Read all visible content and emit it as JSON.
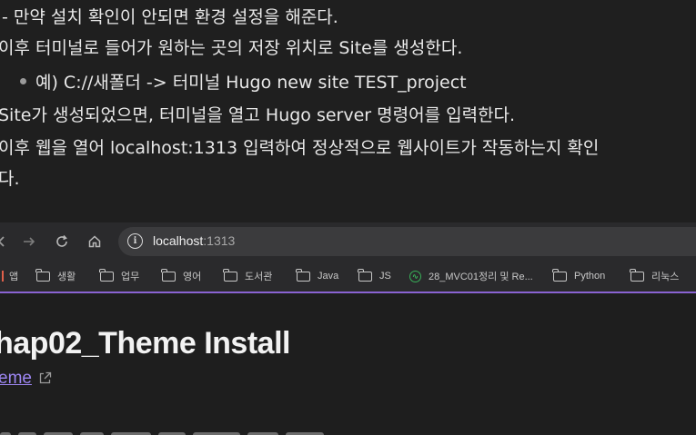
{
  "doc": {
    "lines": [
      "- 만약 설치 확인이 안되면 환경 설정을 해준다.",
      "이후 터미널로 들어가 원하는 곳의 저장 위치로 Site를 생성한다.",
      "예) C://새폴더 -> 터미널 Hugo new site TEST_project",
      "Site가 생성되었으면, 터미널을 열고 Hugo server 명령어를 입력한다.",
      "이후 웹을 열어 localhost:1313 입력하여 정상적으로 웹사이트가 작동하는지 확인",
      "다."
    ]
  },
  "browser": {
    "address": {
      "host": "localhost",
      "port": ":1313"
    },
    "bookmarks": [
      "앱",
      "생활",
      "업무",
      "영어",
      "도서관",
      "Java",
      "JS",
      "28_MVC01정리 및 Re...",
      "Python",
      "리눅스"
    ],
    "page": {
      "title": "hap02_Theme Install",
      "link": "eme"
    }
  },
  "colors": {
    "accent": "#8a63d2",
    "link": "#9d86f2",
    "background": "#1f1f1f"
  }
}
